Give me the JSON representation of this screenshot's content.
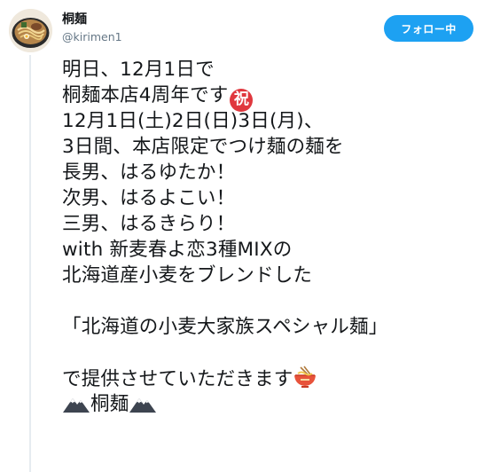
{
  "user": {
    "display_name": "桐麺",
    "handle": "@kirimen1"
  },
  "follow_button": {
    "label": "フォロー中",
    "color": "#1da1f2"
  },
  "tweet": {
    "lines": [
      "明日、12月1日で",
      "桐麺本店4周年です",
      "12月1日(土)2日(日)3日(月)、",
      "3日間、本店限定でつけ麺の麺を",
      "長男、はるゆたか！",
      "次男、はるよこい！",
      "三男、はるきらり！",
      "with 新麦春よ恋3種MIXの",
      "北海道産小麦をブレンドした",
      "",
      "「北海道の小麦大家族スペシャル麺」",
      "",
      "で提供させていただきます",
      "桐麺"
    ],
    "congrats_glyph": "祝",
    "emojis": {
      "congrats": "congratulations-icon",
      "noodles": "ramen-bowl-icon",
      "mountain": "snow-mountain-icon"
    }
  },
  "colors": {
    "text": "#14171a",
    "secondary": "#657786",
    "accent": "#1da1f2",
    "congrats_red": "#e0383e"
  }
}
